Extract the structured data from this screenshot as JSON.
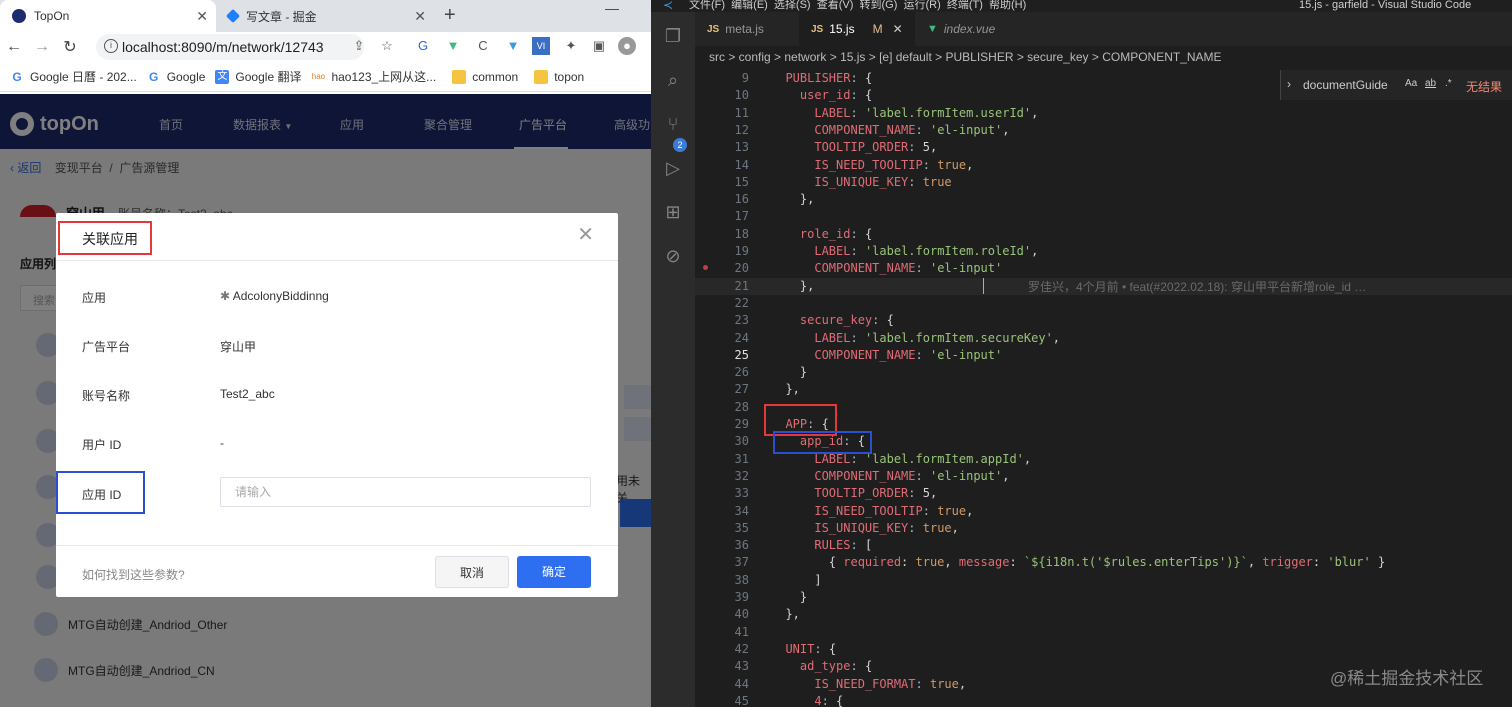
{
  "browser": {
    "tabs": [
      {
        "title": "TopOn"
      },
      {
        "title": "写文章 - 掘金"
      }
    ],
    "url": "localhost:8090/m/network/12743",
    "bookmarks": [
      "Google 日曆 - 202...",
      "Google",
      "Google 翻译",
      "hao123_上网从这...",
      "common",
      "topon"
    ]
  },
  "topon": {
    "logo": "topOn",
    "nav": [
      "首页",
      "数据报表",
      "应用",
      "聚合管理",
      "广告平台",
      "高级功"
    ],
    "breadcrumb": {
      "back": "返回",
      "items": [
        "变现平台",
        "广告源管理"
      ]
    },
    "bg_header": {
      "name": "穿山甲",
      "account": "账号名称：Test2_abc"
    },
    "bg_sidebar": {
      "list_label": "应用列",
      "search_placeholder": "搜索"
    },
    "bg_rows": [
      "MTG自动创建_Andriod_Other",
      "MTG自动创建_Andriod_CN"
    ],
    "bg_side_text": "用未关"
  },
  "modal": {
    "title": "关联应用",
    "fields": [
      {
        "label": "应用",
        "value": "AdcolonyBiddinng"
      },
      {
        "label": "广告平台",
        "value": "穿山甲"
      },
      {
        "label": "账号名称",
        "value": "Test2_abc"
      },
      {
        "label": "用户 ID",
        "value": "-"
      },
      {
        "label": "应用 ID",
        "placeholder": "请输入"
      }
    ],
    "help": "如何找到这些参数?",
    "cancel": "取消",
    "ok": "确定"
  },
  "vscode": {
    "title_menu": "文件(F)  编辑(E)  选择(S)  查看(V)  转到(G)  运行(R)  终端(T)  帮助(H)",
    "title_right": "15.js - garfield - Visual Studio Code",
    "tabs": [
      {
        "name": "meta.js"
      },
      {
        "name": "15.js",
        "status": "M"
      },
      {
        "name": "index.vue"
      }
    ],
    "breadcrumb": "src > config > network > 15.js > [e] default > PUBLISHER > secure_key > COMPONENT_NAME",
    "find": {
      "query": "documentGuide",
      "result": "无结果",
      "opt1": "Aa",
      "opt2": "ab",
      "opt3": ".*"
    },
    "blame": "罗佳兴，4个月前 • feat(#2022.02.18): 穿山甲平台新增role_id …",
    "lines": [
      {
        "n": "9",
        "t": "  PUBLISHER: {"
      },
      {
        "n": "10",
        "t": "    user_id: {"
      },
      {
        "n": "11",
        "t": "      LABEL: 'label.formItem.userId',"
      },
      {
        "n": "12",
        "t": "      COMPONENT_NAME: 'el-input',"
      },
      {
        "n": "13",
        "t": "      TOOLTIP_ORDER: 5,"
      },
      {
        "n": "14",
        "t": "      IS_NEED_TOOLTIP: true,"
      },
      {
        "n": "15",
        "t": "      IS_UNIQUE_KEY: true"
      },
      {
        "n": "16",
        "t": "    },"
      },
      {
        "n": "17",
        "t": ""
      },
      {
        "n": "18",
        "t": "    role_id: {"
      },
      {
        "n": "19",
        "t": "      LABEL: 'label.formItem.roleId',"
      },
      {
        "n": "20",
        "t": "      COMPONENT_NAME: 'el-input'"
      },
      {
        "n": "21",
        "t": "    },"
      },
      {
        "n": "22",
        "t": ""
      },
      {
        "n": "23",
        "t": "    secure_key: {"
      },
      {
        "n": "24",
        "t": "      LABEL: 'label.formItem.secureKey',"
      },
      {
        "n": "25",
        "t": "      COMPONENT_NAME: 'el-input'"
      },
      {
        "n": "26",
        "t": "    }"
      },
      {
        "n": "27",
        "t": "  },"
      },
      {
        "n": "28",
        "t": ""
      },
      {
        "n": "29",
        "t": "  APP: {"
      },
      {
        "n": "30",
        "t": "    app_id: {"
      },
      {
        "n": "31",
        "t": "      LABEL: 'label.formItem.appId',"
      },
      {
        "n": "32",
        "t": "      COMPONENT_NAME: 'el-input',"
      },
      {
        "n": "33",
        "t": "      TOOLTIP_ORDER: 5,"
      },
      {
        "n": "34",
        "t": "      IS_NEED_TOOLTIP: true,"
      },
      {
        "n": "35",
        "t": "      IS_UNIQUE_KEY: true,"
      },
      {
        "n": "36",
        "t": "      RULES: ["
      },
      {
        "n": "37",
        "t": "        { required: true, message: `${i18n.t('$rules.enterTips')}`, trigger: 'blur' }"
      },
      {
        "n": "38",
        "t": "      ]"
      },
      {
        "n": "39",
        "t": "    }"
      },
      {
        "n": "40",
        "t": "  },"
      },
      {
        "n": "41",
        "t": ""
      },
      {
        "n": "42",
        "t": "  UNIT: {"
      },
      {
        "n": "43",
        "t": "    ad_type: {"
      },
      {
        "n": "44",
        "t": "      IS_NEED_FORMAT: true,"
      },
      {
        "n": "45",
        "t": "      4: {"
      }
    ]
  },
  "watermark": "@稀土掘金技术社区"
}
